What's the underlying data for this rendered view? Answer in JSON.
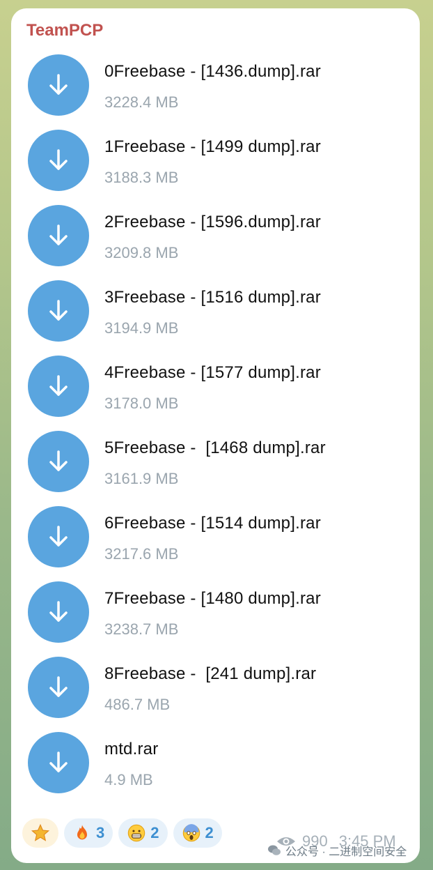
{
  "sender": "TeamPCP",
  "files": [
    {
      "name": "0Freebase - [1436.dump].rar",
      "size": "3228.4 MB"
    },
    {
      "name": "1Freebase - [1499 dump].rar",
      "size": "3188.3 MB"
    },
    {
      "name": "2Freebase - [1596.dump].rar",
      "size": "3209.8 MB"
    },
    {
      "name": "3Freebase - [1516 dump].rar",
      "size": "3194.9 MB"
    },
    {
      "name": "4Freebase - [1577 dump].rar",
      "size": "3178.0 MB"
    },
    {
      "name": "5Freebase -  [1468 dump].rar",
      "size": "3161.9 MB"
    },
    {
      "name": "6Freebase - [1514 dump].rar",
      "size": "3217.6 MB"
    },
    {
      "name": "7Freebase - [1480 dump].rar",
      "size": "3238.7 MB"
    },
    {
      "name": "8Freebase -  [241 dump].rar",
      "size": "486.7 MB"
    },
    {
      "name": "mtd.rar",
      "size": "4.9 MB"
    }
  ],
  "reactions": [
    {
      "emoji": "star-icon",
      "count": ""
    },
    {
      "emoji": "fire-icon",
      "count": "3"
    },
    {
      "emoji": "grin-icon",
      "count": "2"
    },
    {
      "emoji": "scream-icon",
      "count": "2"
    }
  ],
  "views": "990",
  "time": "3:45 PM",
  "watermark": "公众号 · 二进制空间安全",
  "colors": {
    "accent": "#5aa5df",
    "sender": "#c1524f",
    "muted": "#9aa5ae"
  }
}
